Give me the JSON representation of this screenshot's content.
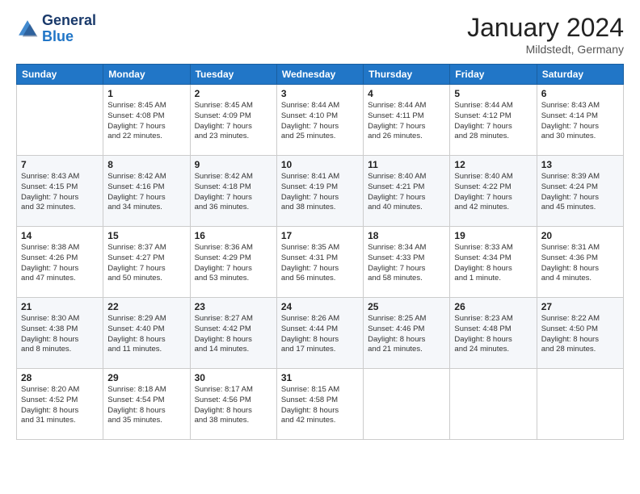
{
  "header": {
    "logo_text_general": "General",
    "logo_text_blue": "Blue",
    "month_title": "January 2024",
    "location": "Mildstedt, Germany"
  },
  "weekdays": [
    "Sunday",
    "Monday",
    "Tuesday",
    "Wednesday",
    "Thursday",
    "Friday",
    "Saturday"
  ],
  "weeks": [
    [
      {
        "day": "",
        "info": ""
      },
      {
        "day": "1",
        "info": "Sunrise: 8:45 AM\nSunset: 4:08 PM\nDaylight: 7 hours\nand 22 minutes."
      },
      {
        "day": "2",
        "info": "Sunrise: 8:45 AM\nSunset: 4:09 PM\nDaylight: 7 hours\nand 23 minutes."
      },
      {
        "day": "3",
        "info": "Sunrise: 8:44 AM\nSunset: 4:10 PM\nDaylight: 7 hours\nand 25 minutes."
      },
      {
        "day": "4",
        "info": "Sunrise: 8:44 AM\nSunset: 4:11 PM\nDaylight: 7 hours\nand 26 minutes."
      },
      {
        "day": "5",
        "info": "Sunrise: 8:44 AM\nSunset: 4:12 PM\nDaylight: 7 hours\nand 28 minutes."
      },
      {
        "day": "6",
        "info": "Sunrise: 8:43 AM\nSunset: 4:14 PM\nDaylight: 7 hours\nand 30 minutes."
      }
    ],
    [
      {
        "day": "7",
        "info": "Sunrise: 8:43 AM\nSunset: 4:15 PM\nDaylight: 7 hours\nand 32 minutes."
      },
      {
        "day": "8",
        "info": "Sunrise: 8:42 AM\nSunset: 4:16 PM\nDaylight: 7 hours\nand 34 minutes."
      },
      {
        "day": "9",
        "info": "Sunrise: 8:42 AM\nSunset: 4:18 PM\nDaylight: 7 hours\nand 36 minutes."
      },
      {
        "day": "10",
        "info": "Sunrise: 8:41 AM\nSunset: 4:19 PM\nDaylight: 7 hours\nand 38 minutes."
      },
      {
        "day": "11",
        "info": "Sunrise: 8:40 AM\nSunset: 4:21 PM\nDaylight: 7 hours\nand 40 minutes."
      },
      {
        "day": "12",
        "info": "Sunrise: 8:40 AM\nSunset: 4:22 PM\nDaylight: 7 hours\nand 42 minutes."
      },
      {
        "day": "13",
        "info": "Sunrise: 8:39 AM\nSunset: 4:24 PM\nDaylight: 7 hours\nand 45 minutes."
      }
    ],
    [
      {
        "day": "14",
        "info": "Sunrise: 8:38 AM\nSunset: 4:26 PM\nDaylight: 7 hours\nand 47 minutes."
      },
      {
        "day": "15",
        "info": "Sunrise: 8:37 AM\nSunset: 4:27 PM\nDaylight: 7 hours\nand 50 minutes."
      },
      {
        "day": "16",
        "info": "Sunrise: 8:36 AM\nSunset: 4:29 PM\nDaylight: 7 hours\nand 53 minutes."
      },
      {
        "day": "17",
        "info": "Sunrise: 8:35 AM\nSunset: 4:31 PM\nDaylight: 7 hours\nand 56 minutes."
      },
      {
        "day": "18",
        "info": "Sunrise: 8:34 AM\nSunset: 4:33 PM\nDaylight: 7 hours\nand 58 minutes."
      },
      {
        "day": "19",
        "info": "Sunrise: 8:33 AM\nSunset: 4:34 PM\nDaylight: 8 hours\nand 1 minute."
      },
      {
        "day": "20",
        "info": "Sunrise: 8:31 AM\nSunset: 4:36 PM\nDaylight: 8 hours\nand 4 minutes."
      }
    ],
    [
      {
        "day": "21",
        "info": "Sunrise: 8:30 AM\nSunset: 4:38 PM\nDaylight: 8 hours\nand 8 minutes."
      },
      {
        "day": "22",
        "info": "Sunrise: 8:29 AM\nSunset: 4:40 PM\nDaylight: 8 hours\nand 11 minutes."
      },
      {
        "day": "23",
        "info": "Sunrise: 8:27 AM\nSunset: 4:42 PM\nDaylight: 8 hours\nand 14 minutes."
      },
      {
        "day": "24",
        "info": "Sunrise: 8:26 AM\nSunset: 4:44 PM\nDaylight: 8 hours\nand 17 minutes."
      },
      {
        "day": "25",
        "info": "Sunrise: 8:25 AM\nSunset: 4:46 PM\nDaylight: 8 hours\nand 21 minutes."
      },
      {
        "day": "26",
        "info": "Sunrise: 8:23 AM\nSunset: 4:48 PM\nDaylight: 8 hours\nand 24 minutes."
      },
      {
        "day": "27",
        "info": "Sunrise: 8:22 AM\nSunset: 4:50 PM\nDaylight: 8 hours\nand 28 minutes."
      }
    ],
    [
      {
        "day": "28",
        "info": "Sunrise: 8:20 AM\nSunset: 4:52 PM\nDaylight: 8 hours\nand 31 minutes."
      },
      {
        "day": "29",
        "info": "Sunrise: 8:18 AM\nSunset: 4:54 PM\nDaylight: 8 hours\nand 35 minutes."
      },
      {
        "day": "30",
        "info": "Sunrise: 8:17 AM\nSunset: 4:56 PM\nDaylight: 8 hours\nand 38 minutes."
      },
      {
        "day": "31",
        "info": "Sunrise: 8:15 AM\nSunset: 4:58 PM\nDaylight: 8 hours\nand 42 minutes."
      },
      {
        "day": "",
        "info": ""
      },
      {
        "day": "",
        "info": ""
      },
      {
        "day": "",
        "info": ""
      }
    ]
  ]
}
